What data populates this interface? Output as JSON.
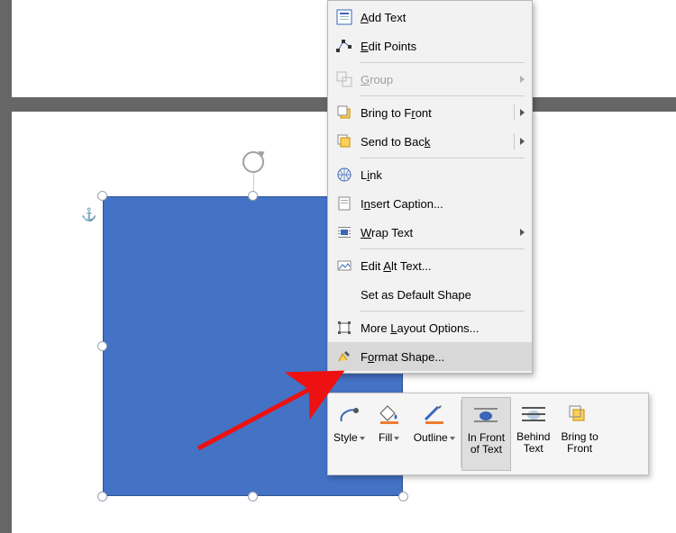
{
  "menu": {
    "add_text": "Add Text",
    "edit_points": "Edit Points",
    "group": "Group",
    "bring_to_front": "Bring to Front",
    "send_to_back": "Send to Back",
    "link": "Link",
    "insert_caption": "Insert Caption...",
    "wrap_text": "Wrap Text",
    "edit_alt_text": "Edit Alt Text...",
    "set_as_default": "Set as Default Shape",
    "more_layout": "More Layout Options...",
    "format_shape": "Format Shape..."
  },
  "mini": {
    "style": "Style",
    "fill": "Fill",
    "outline": "Outline",
    "in_front_l1": "In Front",
    "in_front_l2": "of Text",
    "behind_l1": "Behind",
    "behind_l2": "Text",
    "bring_l1": "Bring to",
    "bring_l2": "Front"
  },
  "shape": {
    "fill": "#4472c4",
    "outline": "#2e5395"
  }
}
